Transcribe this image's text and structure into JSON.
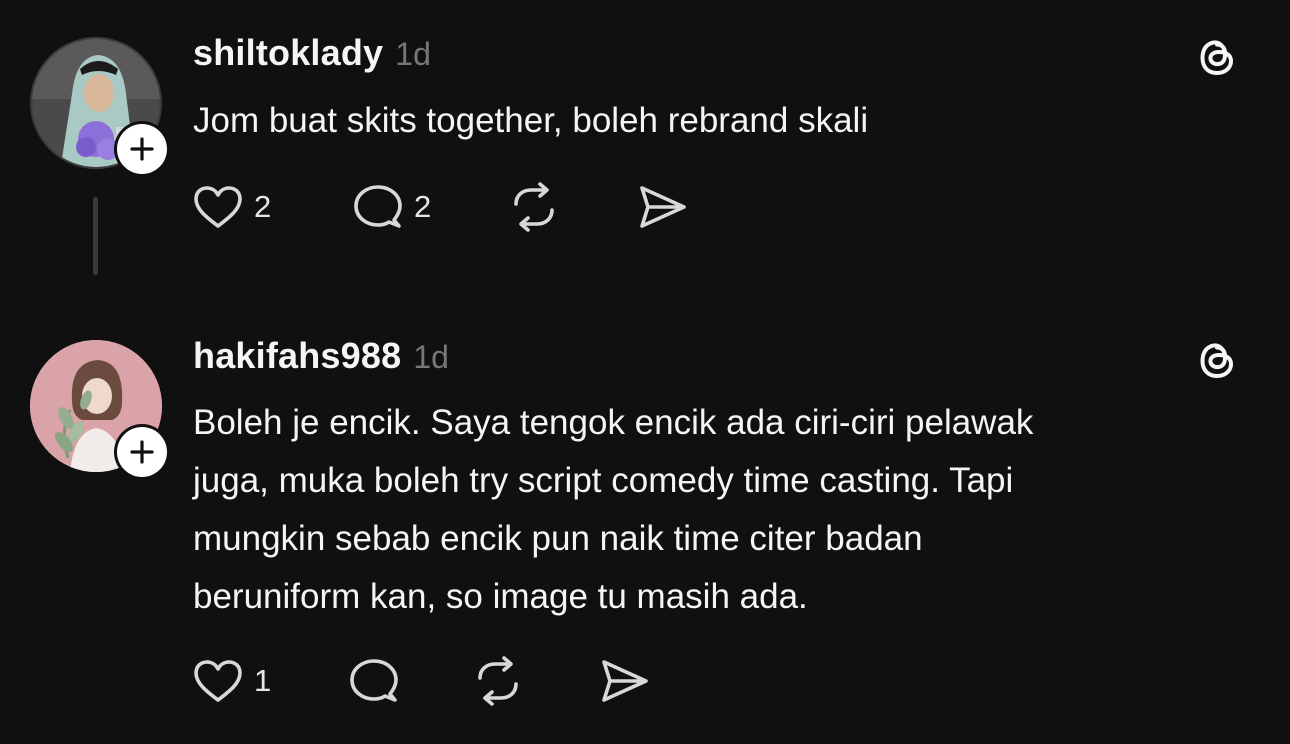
{
  "comments": [
    {
      "username": "shiltoklady",
      "time": "1d",
      "text": "Jom buat skits together, boleh rebrand skali",
      "like_count": "2",
      "reply_count": "2",
      "avatar_icon": "avatar-woman-hijab",
      "follow_icon": "plus-icon",
      "app_icon": "threads-logo-icon"
    },
    {
      "username": "hakifahs988",
      "time": "1d",
      "text_lines": [
        "Boleh je encik. Saya tengok encik ada ciri-ciri pelawak",
        "juga, muka boleh try script comedy time casting. Tapi",
        "mungkin sebab encik pun naik time citer badan",
        "beruniform kan, so image tu masih ada."
      ],
      "like_count": "1",
      "reply_count": "",
      "avatar_icon": "avatar-illustration-woman-leaves",
      "follow_icon": "plus-icon",
      "app_icon": "threads-logo-icon"
    }
  ],
  "colors": {
    "background": "#101010",
    "text": "#f3f5f7",
    "muted": "#777777",
    "icon": "#d8d8d8"
  }
}
